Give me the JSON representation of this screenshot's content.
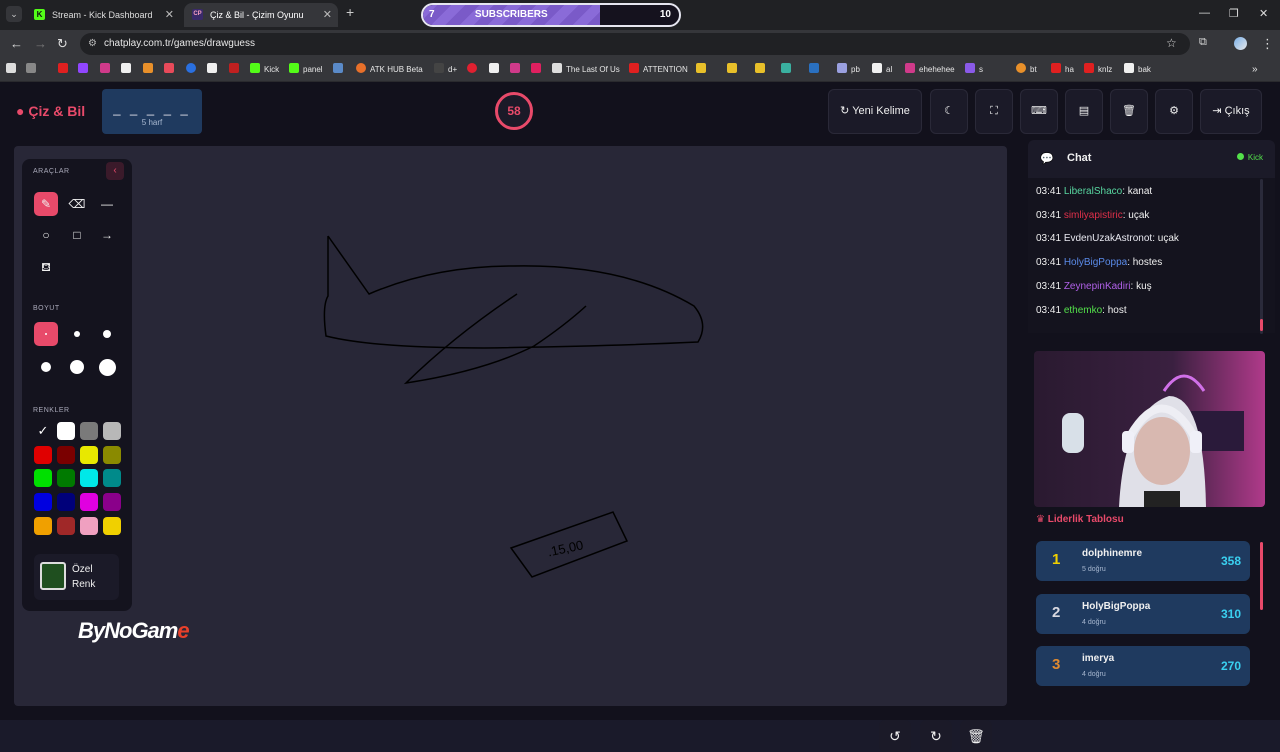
{
  "browser": {
    "tabs": [
      {
        "title": "Stream - Kick Dashboard",
        "favicon": "K"
      },
      {
        "title": "Çiz & Bil - Çizim Oyunu",
        "favicon": "CP"
      }
    ],
    "subscribers": {
      "current": "7",
      "label": "SUBSCRIBERS",
      "goal": "10",
      "progress": 0.69
    },
    "url": "chatplay.com.tr/games/drawguess",
    "bookmarks": [
      "Kick",
      "panel",
      "ATK HUB Beta",
      "d+",
      "The Last Of Us",
      "ATTENTION",
      "pb",
      "al",
      "ehehehee",
      "s",
      "bt",
      "ha",
      "knlz",
      "bak"
    ]
  },
  "header": {
    "logo": "Çiz & Bil",
    "word_blanks": "_ _ _ _ _",
    "word_hint": "5 harf",
    "timer": "58",
    "new_word": "Yeni Kelime",
    "exit": "Çıkış"
  },
  "tools": {
    "section_tools": "ARAÇLAR",
    "section_size": "BOYUT",
    "section_colors": "RENKLER",
    "custom_color_line1": "Özel",
    "custom_color_line2": "Renk",
    "colors": [
      "#111111",
      "#ffffff",
      "#7a7a7a",
      "#b8b8b8",
      "#e00000",
      "#7a0000",
      "#e8e800",
      "#8a8a00",
      "#00e000",
      "#007a00",
      "#00e8e8",
      "#008a8a",
      "#0000e0",
      "#00007a",
      "#e000e0",
      "#8a008a",
      "#f0a000",
      "#a02828",
      "#f0a0c0",
      "#f0d000"
    ],
    "custom_color": "#1f4f1f"
  },
  "brand": {
    "text1": "ByNoGam",
    "text2": "e"
  },
  "canvas_text": ".15,00",
  "chat": {
    "title": "Chat",
    "source": "Kick",
    "messages": [
      {
        "time": "03:41",
        "user": "LiberalShaco",
        "color": "#58d6a0",
        "text": "kanat"
      },
      {
        "time": "03:41",
        "user": "simliyapistiric",
        "color": "#e0304a",
        "text": "uçak"
      },
      {
        "time": "03:41",
        "user": "EvdenUzakAstronot",
        "color": "#e8e8f0",
        "text": "uçak"
      },
      {
        "time": "03:41",
        "user": "HolyBigPoppa",
        "color": "#5a8ae8",
        "text": "hostes"
      },
      {
        "time": "03:41",
        "user": "ZeynepinKadiri",
        "color": "#b060e8",
        "text": "kuş"
      },
      {
        "time": "03:41",
        "user": "ethemko",
        "color": "#53e04a",
        "text": "host"
      }
    ]
  },
  "leaderboard": {
    "title": "Liderlik Tablosu",
    "rows": [
      {
        "rank": "1",
        "name": "dolphinemre",
        "sub": "5 doğru",
        "score": "358",
        "rank_color": "#f0d000"
      },
      {
        "rank": "2",
        "name": "HolyBigPoppa",
        "sub": "4 doğru",
        "score": "310",
        "rank_color": "#d8d8e0"
      },
      {
        "rank": "3",
        "name": "imerya",
        "sub": "4 doğru",
        "score": "270",
        "rank_color": "#e08a30"
      }
    ]
  }
}
